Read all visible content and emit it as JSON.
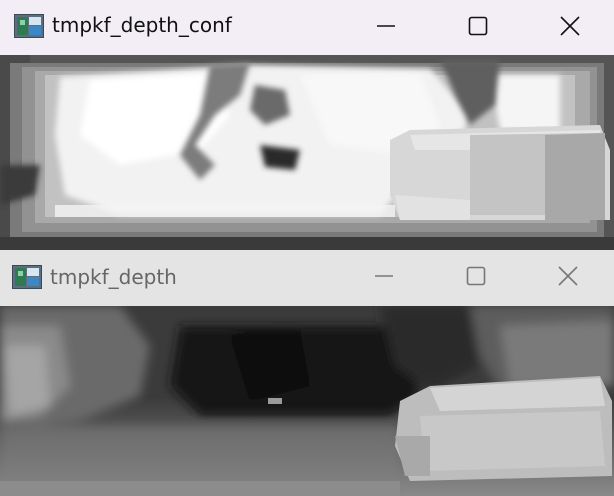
{
  "windows": [
    {
      "title": "tmpkf_depth_conf",
      "active": true,
      "controls": {
        "minimize_icon": "minimize-icon",
        "maximize_icon": "maximize-icon",
        "close_icon": "close-icon"
      },
      "content": "confidence-map-image"
    },
    {
      "title": "tmpkf_depth",
      "active": false,
      "controls": {
        "minimize_icon": "minimize-icon",
        "maximize_icon": "maximize-icon",
        "close_icon": "close-icon"
      },
      "content": "depth-map-image"
    }
  ],
  "colors": {
    "active_titlebar": "#f3eef6",
    "inactive_titlebar": "#e4e4e4",
    "active_text": "#111111",
    "inactive_text": "#666666"
  }
}
